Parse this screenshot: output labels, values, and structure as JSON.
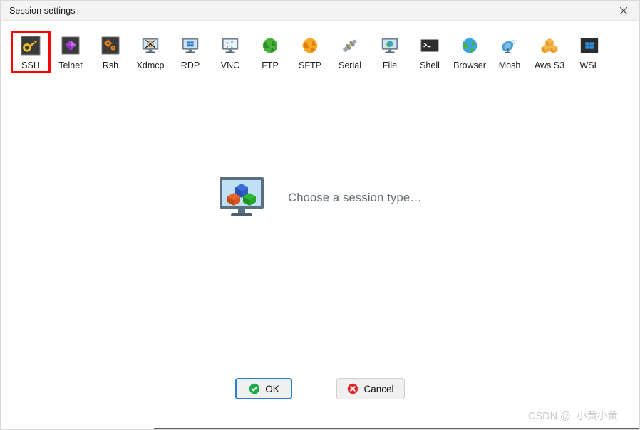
{
  "window": {
    "title": "Session settings",
    "close_label": "✕",
    "close_icon": "close-icon"
  },
  "toolbar": {
    "selected": "SSH",
    "highlight_color": "#ff0000",
    "items": [
      {
        "label": "SSH",
        "icon": "key-icon",
        "selected": true
      },
      {
        "label": "Telnet",
        "icon": "gem-icon",
        "selected": false
      },
      {
        "label": "Rsh",
        "icon": "gears-icon",
        "selected": false
      },
      {
        "label": "Xdmcp",
        "icon": "monitor-x-icon",
        "selected": false
      },
      {
        "label": "RDP",
        "icon": "monitor-windows-icon",
        "selected": false
      },
      {
        "label": "VNC",
        "icon": "monitor-vnc-icon",
        "selected": false
      },
      {
        "label": "FTP",
        "icon": "green-globe-icon",
        "selected": false
      },
      {
        "label": "SFTP",
        "icon": "orange-globe-icon",
        "selected": false
      },
      {
        "label": "Serial",
        "icon": "plug-connector-icon",
        "selected": false
      },
      {
        "label": "File",
        "icon": "monitor-globe-icon",
        "selected": false
      },
      {
        "label": "Shell",
        "icon": "terminal-icon",
        "selected": false
      },
      {
        "label": "Browser",
        "icon": "blue-globe-icon",
        "selected": false
      },
      {
        "label": "Mosh",
        "icon": "satellite-dish-icon",
        "selected": false
      },
      {
        "label": "Aws S3",
        "icon": "aws-cubes-icon",
        "selected": false
      },
      {
        "label": "WSL",
        "icon": "windows-tile-icon",
        "selected": false
      }
    ]
  },
  "main": {
    "placeholder_text": "Choose a session type…",
    "placeholder_icon": "monitor-cubes-icon"
  },
  "footer": {
    "ok_label": "OK",
    "ok_icon": "green-check-icon",
    "cancel_label": "Cancel",
    "cancel_icon": "red-x-icon"
  },
  "watermark": {
    "text": "CSDN @_小黄小黄_"
  },
  "colors": {
    "accent_focus": "#2a7fd4",
    "ok_green": "#1faa4b",
    "cancel_red": "#db2b2b",
    "selection_red": "#ff0000",
    "titlebar_bg": "#f3f3f3",
    "body_bg": "#ffffff"
  }
}
